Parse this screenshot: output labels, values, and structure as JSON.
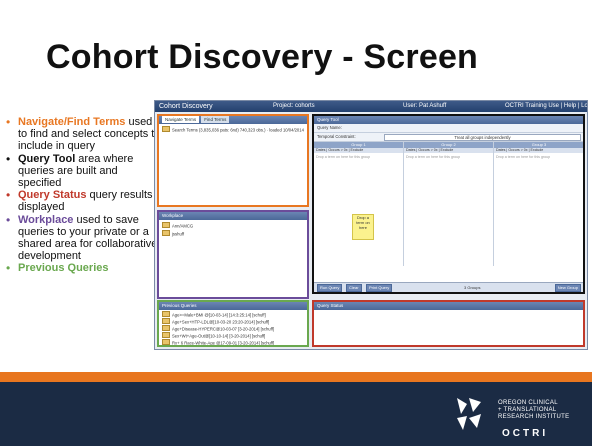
{
  "slide": {
    "title": "Cohort Discovery - Screen"
  },
  "bullets": [
    {
      "term": "Navigate/Find Terms",
      "rest": " used to find and select concepts to include in query"
    },
    {
      "term": "Query Tool",
      "rest": " area where queries are built and specified"
    },
    {
      "term": "Query Status",
      "rest": " query results displayed"
    },
    {
      "term": "Workplace",
      "rest": " used to save queries to your private or a shared area for collaborative development"
    },
    {
      "term": "Previous Queries",
      "rest": ""
    }
  ],
  "app": {
    "title": "Cohort Discovery",
    "project": "Project: cohorts",
    "user": "User: Pat Ashuff",
    "links": "OCTRI Training Use | Help | Logout"
  },
  "navigate": {
    "tab1": "Navigate Terms",
    "tab2": "Find Terms",
    "item": "Search Terms (3,835,036 pats: 6nd) 740,323 obs.) · loaded 10/04/2014"
  },
  "workplace": {
    "head": "Workplace",
    "items": [
      "Ann/AMCG",
      "jsshuff"
    ]
  },
  "previous": {
    "head": "Previous Queries",
    "items": [
      "Age>=Male+BMI @[10-03-14] [14:3:25:14] [schuff]",
      "Age+Sex+HTP-LDL@[10-03-20 23:20-2014] [schuff]",
      "Age+Disease-HYPERC@10-03-07 [3-20-2014] [schuff]",
      "Sex+Wt+Age-Out@[10-10-14] [3-20-2014] [schuff]",
      "Rx+ 6 Race-White-Age @17-09-01 [3-20-2014] [schuff]"
    ]
  },
  "querytool": {
    "head": "Query Tool",
    "name_label": "Query Name:",
    "constraint_label": "Temporal Constraint:",
    "constraint_value": "Treat all groups independently",
    "groups": [
      "Group 1",
      "Group 2",
      "Group 3"
    ],
    "group_cols": "Dates | Occurs > 0x | Exclude",
    "drop_hint": "Drop a term on here for this group",
    "sticky": "Drop a term on here",
    "buttons": [
      "Run Query",
      "Clear",
      "Print Query"
    ],
    "groups_count": "3 Groups",
    "new_group": "New Group"
  },
  "status": {
    "head": "Query Status"
  },
  "logo": {
    "line1": "OREGON CLINICAL",
    "line2": "+ TRANSLATIONAL",
    "line3": "RESEARCH INSTITUTE",
    "word": "OCTRI"
  },
  "colors": {
    "orange": "#e87722",
    "red": "#c0392b",
    "purple": "#6b4c9a",
    "green": "#6aa84f",
    "footer": "#1b2b44"
  }
}
